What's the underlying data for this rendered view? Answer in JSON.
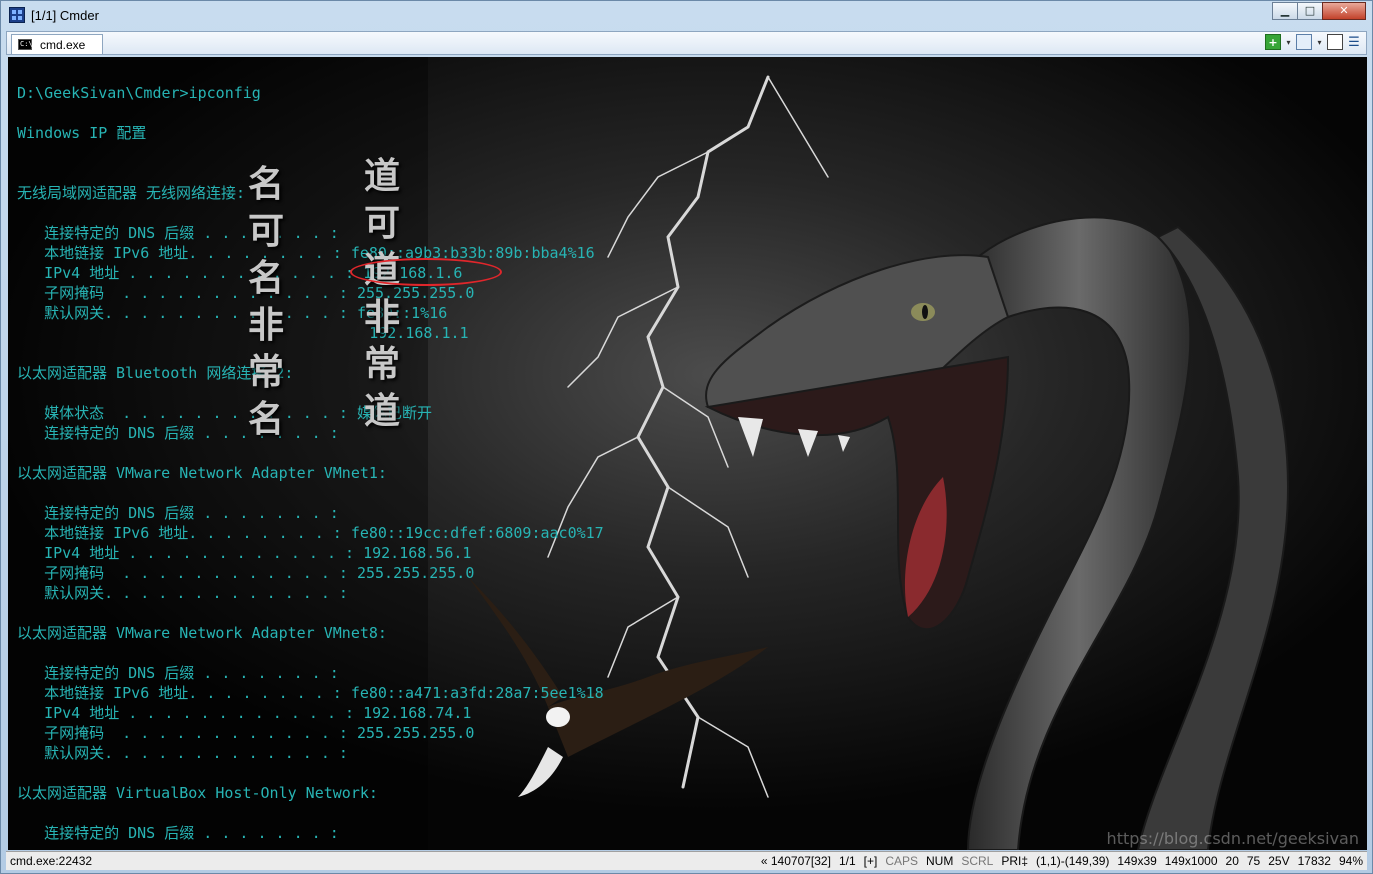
{
  "window": {
    "title": "[1/1] Cmder",
    "buttons": {
      "minimize": "▁",
      "maximize": "□",
      "close": "✕"
    }
  },
  "tabbar": {
    "tab_icon_text": "C:\\",
    "tab_label": "cmd.exe",
    "tools": {
      "add": "+",
      "add_menu": "▾",
      "view_menu": "▾"
    }
  },
  "terminal": {
    "lines": [
      "D:\\GeekSivan\\Cmder>ipconfig",
      "",
      "Windows IP 配置",
      "",
      "",
      "无线局域网适配器 无线网络连接:",
      "",
      "   连接特定的 DNS 后缀 . . . . . . . :",
      "   本地链接 IPv6 地址. . . . . . . . : fe80::a9b3:b33b:89b:bba4%16",
      "   IPv4 地址 . . . . . . . . . . . . : 192.168.1.6",
      "   子网掩码  . . . . . . . . . . . . : 255.255.255.0",
      "   默认网关. . . . . . . . . . . . . : fe80::1%16",
      "                                       192.168.1.1",
      "",
      "以太网适配器 Bluetooth 网络连接 2:",
      "",
      "   媒体状态  . . . . . . . . . . . . : 媒体已断开",
      "   连接特定的 DNS 后缀 . . . . . . . :",
      "",
      "以太网适配器 VMware Network Adapter VMnet1:",
      "",
      "   连接特定的 DNS 后缀 . . . . . . . :",
      "   本地链接 IPv6 地址. . . . . . . . : fe80::19cc:dfef:6809:aac0%17",
      "   IPv4 地址 . . . . . . . . . . . . : 192.168.56.1",
      "   子网掩码  . . . . . . . . . . . . : 255.255.255.0",
      "   默认网关. . . . . . . . . . . . . :",
      "",
      "以太网适配器 VMware Network Adapter VMnet8:",
      "",
      "   连接特定的 DNS 后缀 . . . . . . . :",
      "   本地链接 IPv6 地址. . . . . . . . : fe80::a471:a3fd:28a7:5ee1%18",
      "   IPv4 地址 . . . . . . . . . . . . : 192.168.74.1",
      "   子网掩码  . . . . . . . . . . . . : 255.255.255.0",
      "   默认网关. . . . . . . . . . . . . :",
      "",
      "以太网适配器 VirtualBox Host-Only Network:",
      "",
      "   连接特定的 DNS 后缀 . . . . . . . :"
    ]
  },
  "background": {
    "calligraphy_left": "名可名非常名",
    "calligraphy_right": "道可道非常道",
    "watermark": "https://blog.csdn.net/geeksivan",
    "colors": {
      "snake": "#4a4a4a",
      "lightning": "#d8d8d8",
      "highlight_ring": "#e0262b"
    }
  },
  "statusbar": {
    "process": "cmd.exe:22432",
    "items": [
      "« 140707[32]",
      "1/1",
      "[+]",
      "CAPS",
      "NUM",
      "SCRL",
      "PRI‡",
      "(1,1)-(149,39)",
      "149x39",
      "149x1000",
      "20",
      "75",
      "25V",
      "17832",
      "94%"
    ]
  }
}
